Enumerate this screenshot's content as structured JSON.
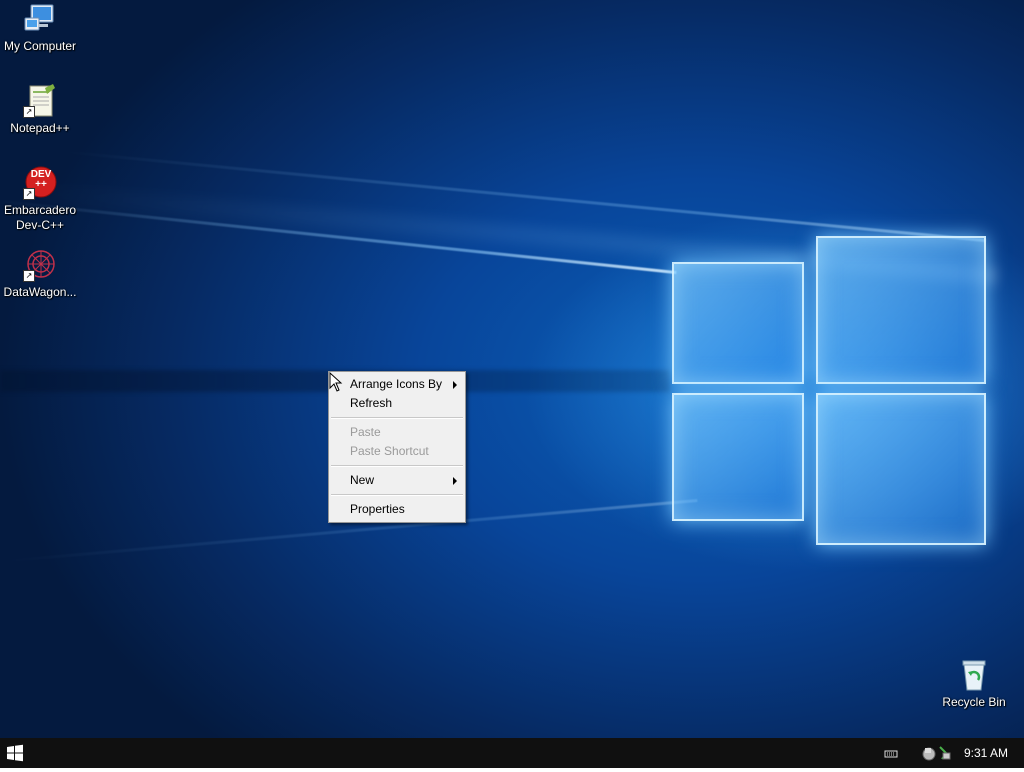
{
  "desktop": {
    "icons": [
      {
        "label": "My Computer",
        "icon": "my-computer-icon"
      },
      {
        "label": "Notepad++",
        "icon": "notepad-plus-plus-icon"
      },
      {
        "label": "Embarcadero\nDev-C++",
        "icon": "dev-cpp-icon",
        "badge": "DEV\n++"
      },
      {
        "label": "DataWagon...",
        "icon": "datawagon-icon"
      },
      {
        "label": "Recycle Bin",
        "icon": "recycle-bin-icon"
      }
    ]
  },
  "context_menu": {
    "items": [
      {
        "label": "Arrange Icons By",
        "enabled": true,
        "submenu": true
      },
      {
        "label": "Refresh",
        "enabled": true,
        "submenu": false
      },
      {
        "label": "Paste",
        "enabled": false,
        "submenu": false
      },
      {
        "label": "Paste Shortcut",
        "enabled": false,
        "submenu": false
      },
      {
        "label": "New",
        "enabled": true,
        "submenu": true
      },
      {
        "label": "Properties",
        "enabled": true,
        "submenu": false
      }
    ]
  },
  "taskbar": {
    "start_icon": "windows-logo-icon",
    "tray_icons": [
      "keyboard-icon",
      "network-icon"
    ],
    "clock": "9:31 AM"
  },
  "colors": {
    "taskbar_bg": "#101010",
    "menu_bg": "#f0f0f0",
    "disabled_text": "#9a9a9a",
    "wallpaper_accent": "#0b5fb8"
  }
}
